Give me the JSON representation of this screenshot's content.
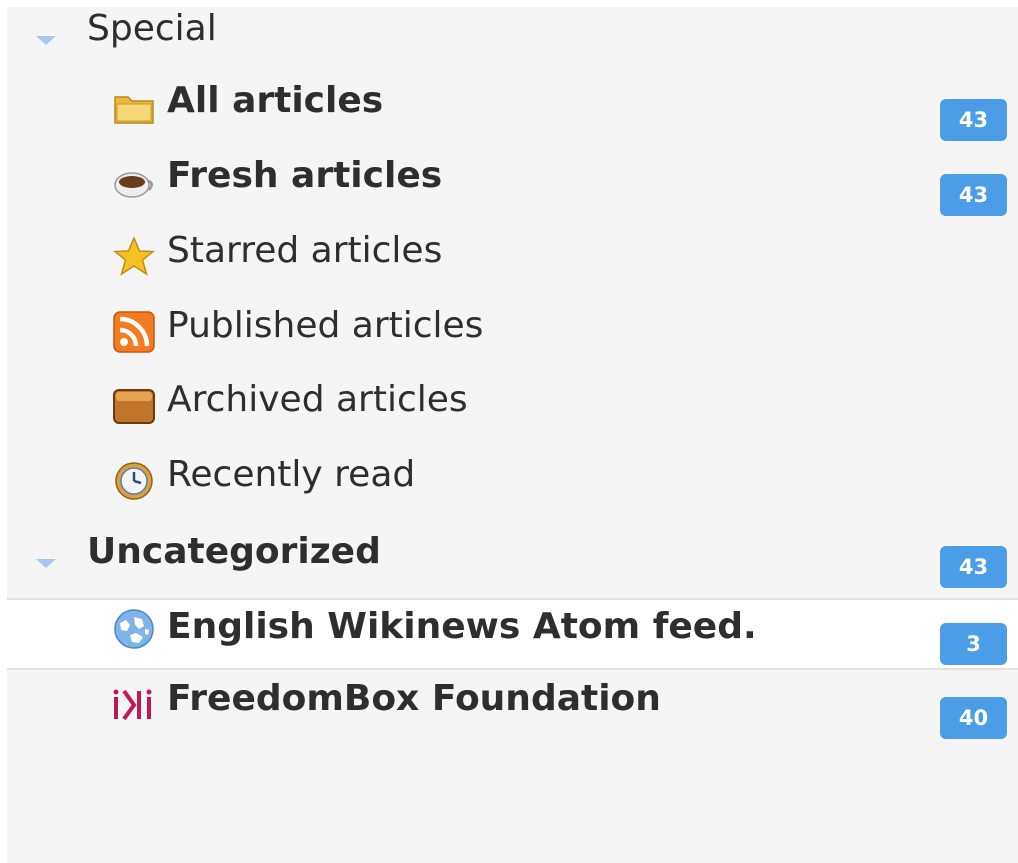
{
  "special": {
    "label": "Special",
    "expanded": true,
    "items": [
      {
        "label": "All articles",
        "count": "43",
        "bold": true,
        "icon": "folder-icon"
      },
      {
        "label": "Fresh articles",
        "count": "43",
        "bold": true,
        "icon": "coffee-cup-icon"
      },
      {
        "label": "Starred articles",
        "count": "",
        "bold": false,
        "icon": "star-icon"
      },
      {
        "label": "Published articles",
        "count": "",
        "bold": false,
        "icon": "rss-icon"
      },
      {
        "label": "Archived articles",
        "count": "",
        "bold": false,
        "icon": "archive-box-icon"
      },
      {
        "label": "Recently read",
        "count": "",
        "bold": false,
        "icon": "clock-icon"
      }
    ]
  },
  "uncategorized": {
    "label": "Uncategorized",
    "count": "43",
    "expanded": true,
    "items": [
      {
        "label": "English Wikinews Atom feed.",
        "count": "3",
        "bold": true,
        "selected": true,
        "icon": "globe-icon"
      },
      {
        "label": "FreedomBox Foundation",
        "count": "40",
        "bold": true,
        "selected": false,
        "icon": "ikiwiki-icon"
      }
    ]
  },
  "colors": {
    "badge": "#4a9de6",
    "panel_bg": "#f5f5f5",
    "selected_bg": "#ffffff",
    "expander": "#a8c6ee",
    "ikiwiki_logo": "#c2185b"
  }
}
